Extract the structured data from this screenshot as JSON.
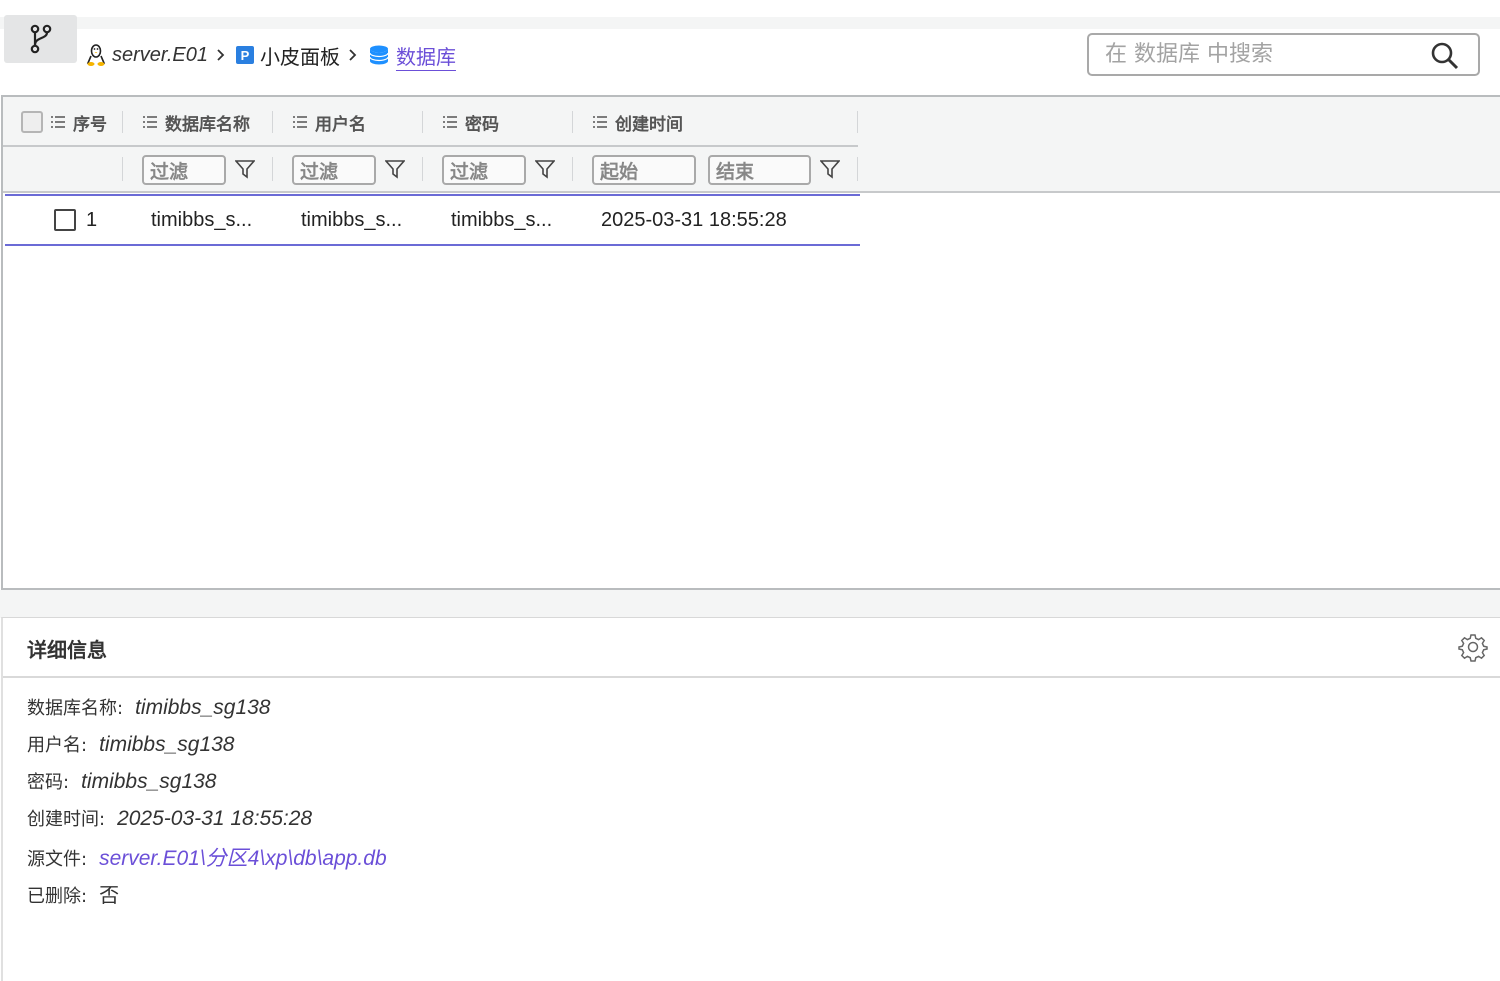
{
  "breadcrumb": {
    "server": "server.E01",
    "panel": "小皮面板",
    "current": "数据库"
  },
  "search": {
    "placeholder": "在 数据库 中搜索"
  },
  "table": {
    "headers": {
      "index": "序号",
      "db_name": "数据库名称",
      "username": "用户名",
      "password": "密码",
      "created": "创建时间"
    },
    "filters": {
      "db_name": "过滤",
      "username": "过滤",
      "password": "过滤",
      "created_start": "起始",
      "created_end": "结束"
    },
    "rows": [
      {
        "index": "1",
        "db_name": "timibbs_s...",
        "username": "timibbs_s...",
        "password": "timibbs_s...",
        "created": "2025-03-31 18:55:28"
      }
    ]
  },
  "details": {
    "title": "详细信息",
    "fields": {
      "db_name_label": "数据库名称:",
      "db_name_value": "timibbs_sg138",
      "username_label": "用户名:",
      "username_value": "timibbs_sg138",
      "password_label": "密码:",
      "password_value": "timibbs_sg138",
      "created_label": "创建时间:",
      "created_value": "2025-03-31 18:55:28",
      "source_label": "源文件:",
      "source_value": "server.E01\\分区4\\xp\\db\\app.db",
      "deleted_label": "已删除:",
      "deleted_value": "否"
    }
  },
  "colors": {
    "accent": "#6b4fd8",
    "selection_border": "#6b6bd6",
    "db_icon": "#1e90ff",
    "p_badge": "#2a7fe0"
  }
}
